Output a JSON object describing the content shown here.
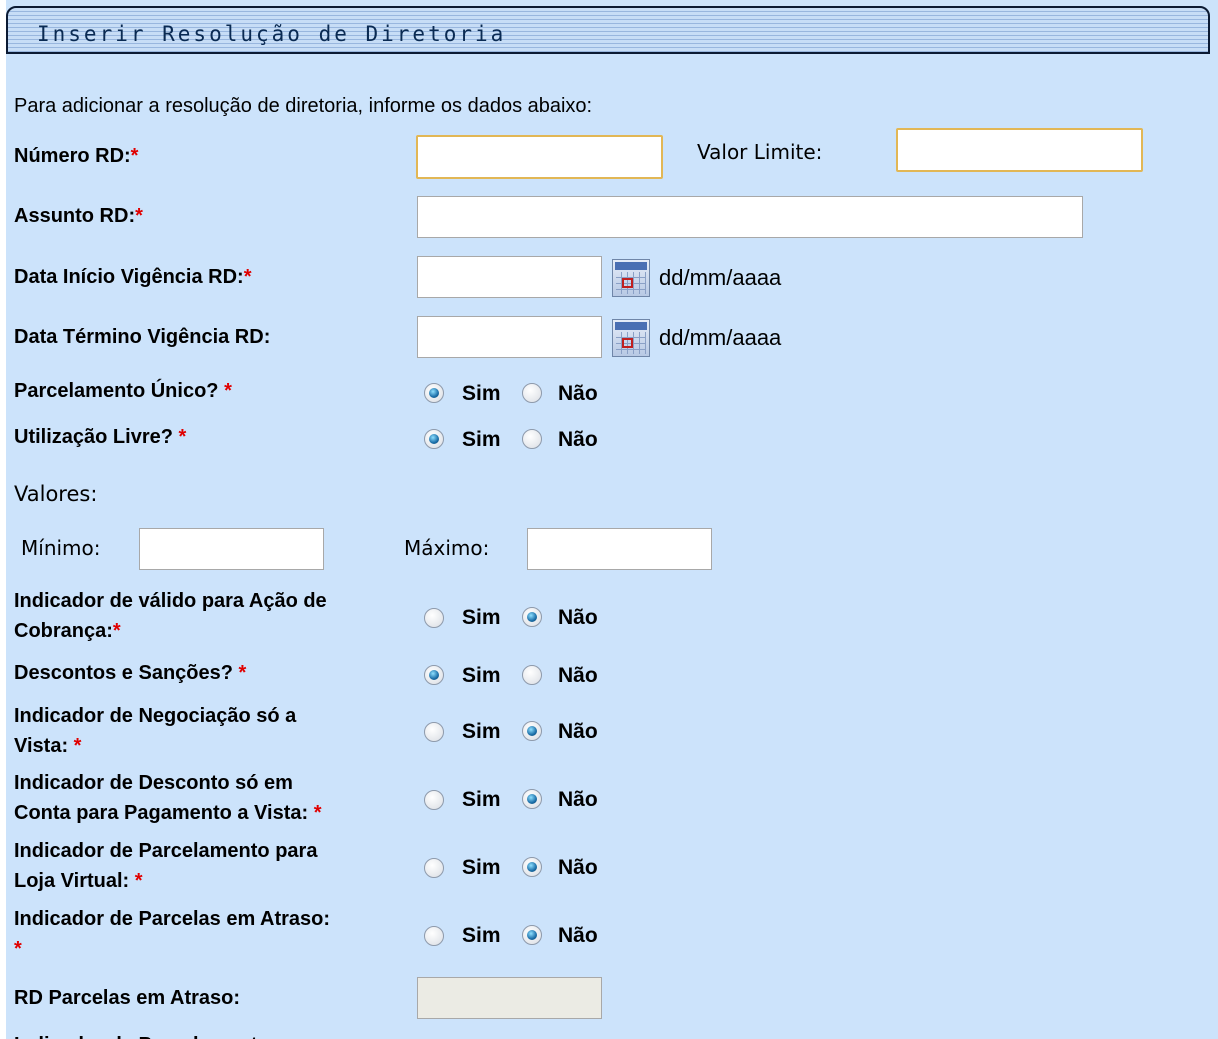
{
  "window_title": "Inserir Resolução de Diretoria",
  "instructions": "Para adicionar a resolução de diretoria, informe os dados abaixo:",
  "required_mark": "*",
  "date_format": "dd/mm/aaaa",
  "options": {
    "yes": "Sim",
    "no": "Não"
  },
  "fields": {
    "numero_rd": {
      "label": "Número RD:",
      "value": ""
    },
    "valor_limite": {
      "label": "Valor Limite:",
      "value": ""
    },
    "assunto_rd": {
      "label": "Assunto RD:",
      "value": ""
    },
    "data_inicio": {
      "label": "Data Início Vigência RD:",
      "value": ""
    },
    "data_termino": {
      "label": "Data Término Vigência RD:",
      "value": ""
    },
    "rd_parcelas_atraso": {
      "label": "RD Parcelas em Atraso:",
      "value": ""
    }
  },
  "valores": {
    "label": "Valores:",
    "minimo": {
      "label": "Mínimo:",
      "value": ""
    },
    "maximo": {
      "label": "Máximo:",
      "value": ""
    }
  },
  "questions": [
    {
      "label": "Parcelamento Único?",
      "selected": "Sim"
    },
    {
      "label": "Utilização Livre?",
      "selected": "Sim"
    },
    {
      "label_line1": "Indicador de válido para Ação de",
      "label_line2": "Cobrança:",
      "selected": "Não"
    },
    {
      "label": "Descontos e Sanções?",
      "selected": "Sim"
    },
    {
      "label_line1": "Indicador de Negociação só a",
      "label_line2": "Vista:",
      "selected": "Não"
    },
    {
      "label_line1": "Indicador de Desconto só em",
      "label_line2": "Conta para Pagamento a Vista:",
      "selected": "Não"
    },
    {
      "label_line1": "Indicador de Parcelamento para",
      "label_line2": "Loja Virtual:",
      "selected": "Não"
    },
    {
      "label_line1": "Indicador de Parcelas em Atraso:",
      "label_line2": "",
      "selected": "Não"
    }
  ],
  "next_row_label_partial": "Indicador de Parcelamento"
}
